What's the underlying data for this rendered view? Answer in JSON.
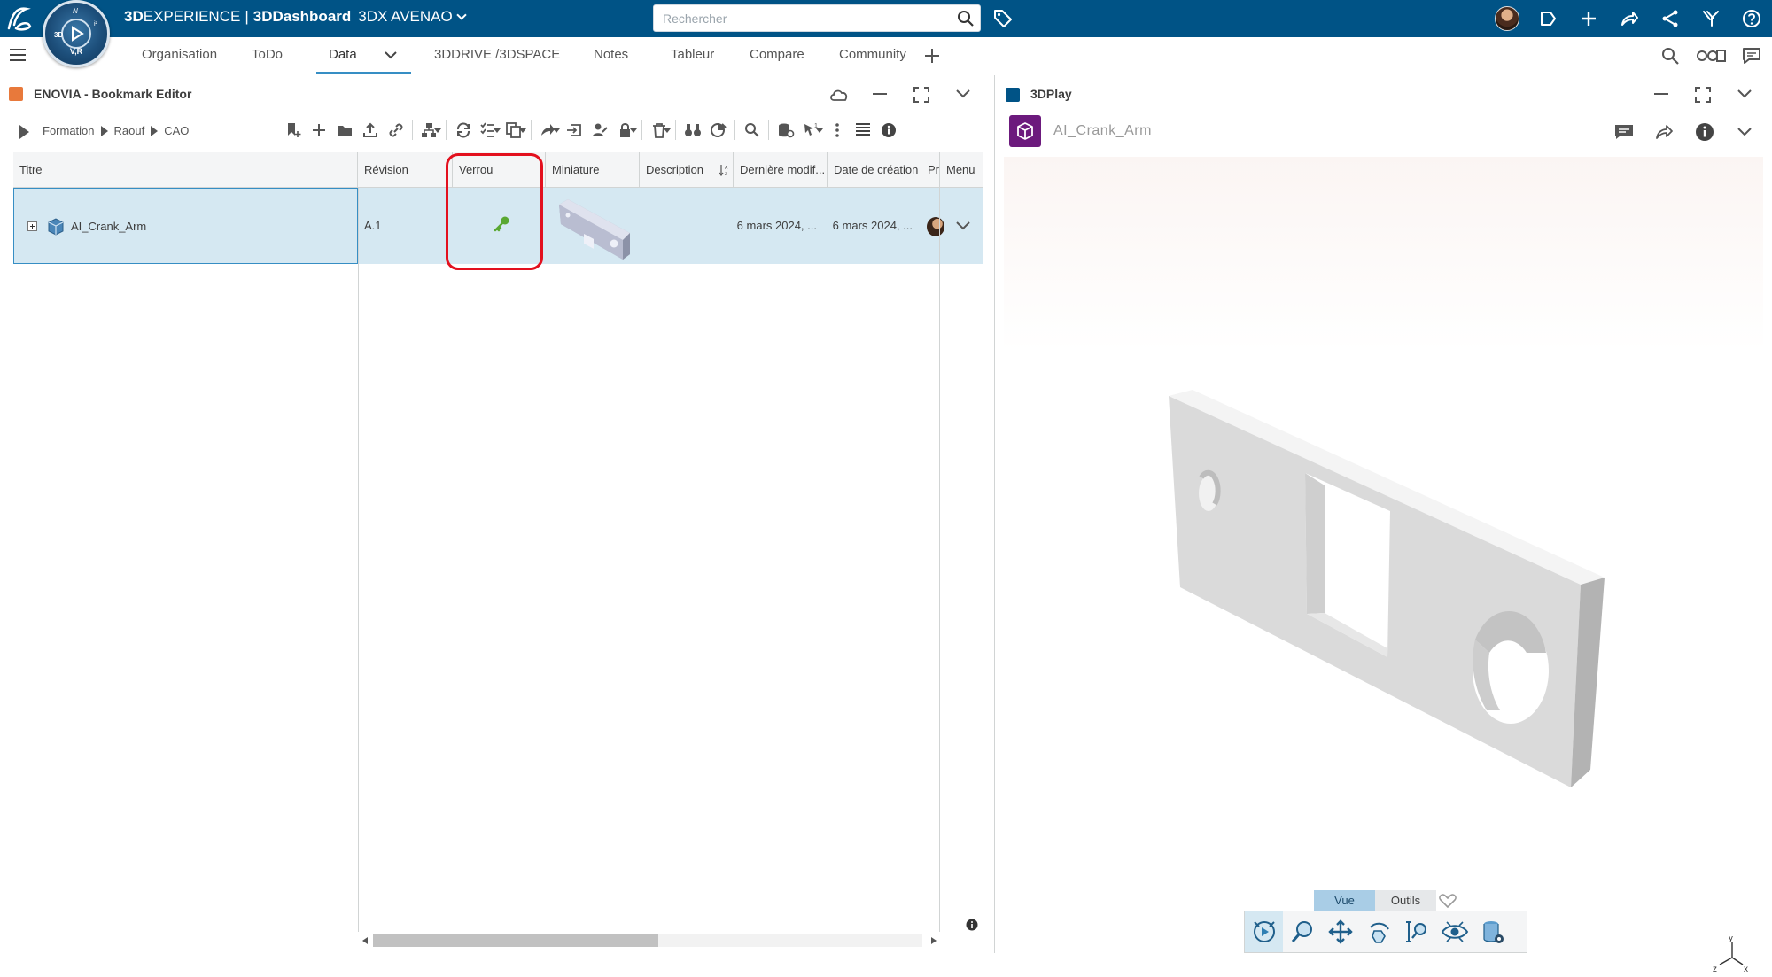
{
  "topbar": {
    "brand_prefix": "3D",
    "brand_experience": "EXPERIENCE",
    "brand_sep": "|",
    "brand_app": "3DDashboard",
    "tenant": "3DX AVENAO",
    "compass_label": "V,R",
    "search_placeholder": "Rechercher"
  },
  "tabs": {
    "items": [
      "Organisation",
      "ToDo",
      "Data",
      "3DDRIVE /3DSPACE",
      "Notes",
      "Tableur",
      "Compare",
      "Community"
    ],
    "active": "Data"
  },
  "left_widget": {
    "title": "ENOVIA - Bookmark Editor",
    "breadcrumb": [
      "Formation",
      "Raouf",
      "CAO"
    ],
    "columns": [
      "Titre",
      "Révision",
      "Verrou",
      "Miniature",
      "Description",
      "Dernière modif...",
      "Date de création",
      "Pr",
      "Menu"
    ],
    "row": {
      "title": "AI_Crank_Arm",
      "revision": "A.1",
      "lock": "key",
      "description": "",
      "last_modified": "6 mars 2024, ...",
      "created": "6 mars 2024, ..."
    }
  },
  "right_widget": {
    "title": "3DPlay",
    "model_name": "AI_Crank_Arm",
    "view_tabs": [
      "Vue",
      "Outils"
    ],
    "active_view_tab": "Vue",
    "axis": {
      "x": "x",
      "y": "y",
      "z": "z"
    }
  },
  "colors": {
    "topbar": "#005386",
    "accent": "#368ec4",
    "selected_row": "#d5e8f2",
    "highlight": "#e3101e",
    "lock_key": "#5aa832",
    "app_icon": "#6c1a7d"
  }
}
